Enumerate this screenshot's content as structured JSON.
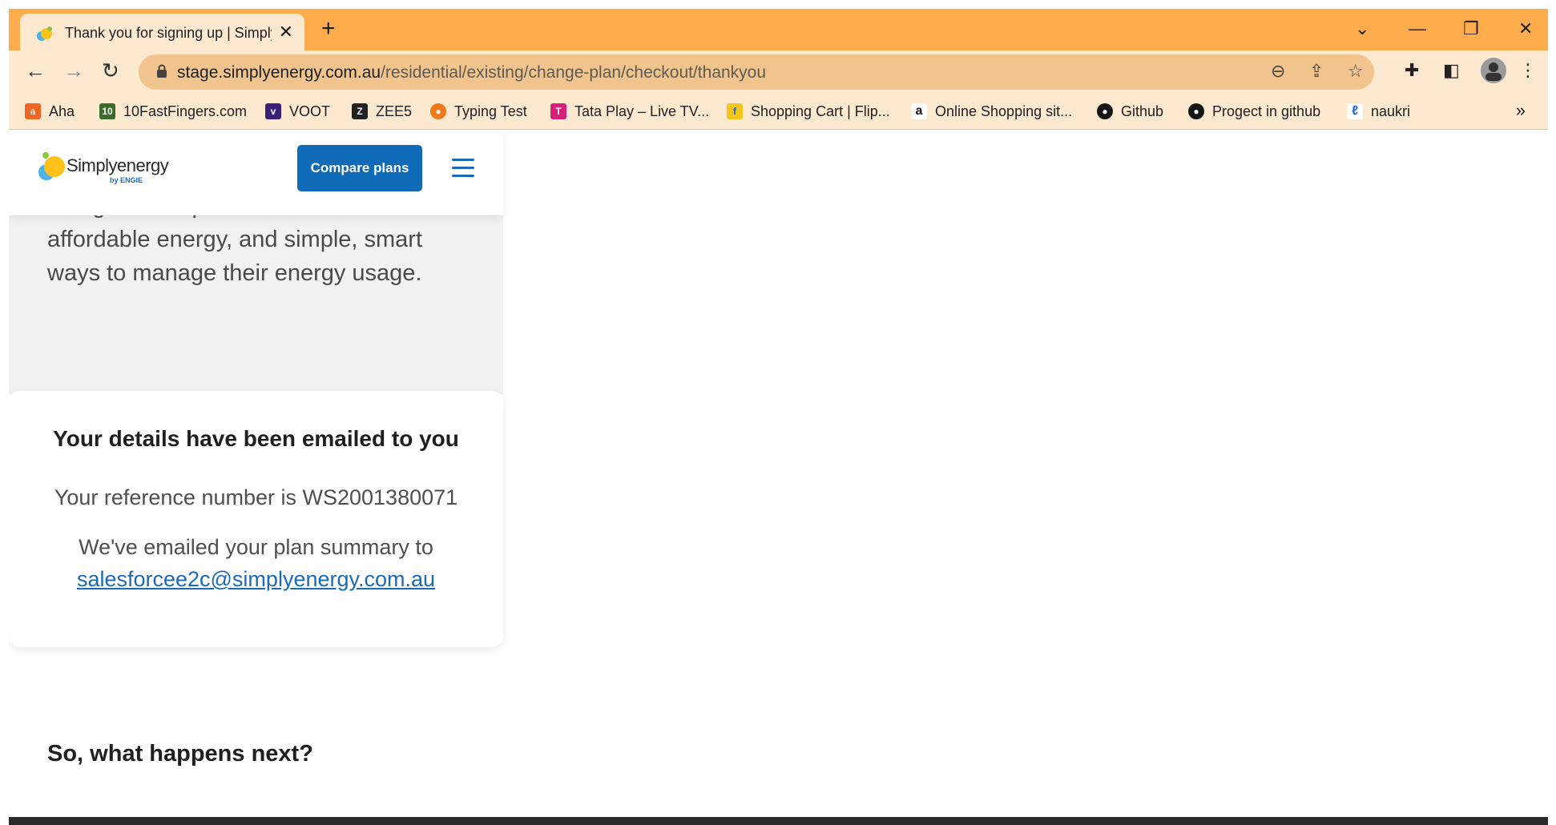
{
  "browser": {
    "tab_title": "Thank you for signing up | Simply",
    "url_host": "stage.simplyenergy.com.au",
    "url_path": "/residential/existing/change-plan/checkout/thankyou",
    "bookmarks": [
      {
        "label": "Aha",
        "color": "#f26522"
      },
      {
        "label": "10FastFingers.com",
        "color": "#3a6b2a"
      },
      {
        "label": "VOOT",
        "color": "#3a1f7a"
      },
      {
        "label": "ZEE5",
        "color": "#222222"
      },
      {
        "label": "Typing Test",
        "color": "#f07a1a"
      },
      {
        "label": "Tata Play – Live TV...",
        "color": "#d6207a"
      },
      {
        "label": "Shopping Cart | Flip...",
        "color": "#f7c51a"
      },
      {
        "label": "Online Shopping sit...",
        "color": "#111111"
      },
      {
        "label": "Github",
        "color": "#161616"
      },
      {
        "label": "Progect in github",
        "color": "#161616"
      },
      {
        "label": "naukri",
        "color": "#1c64d8"
      }
    ]
  },
  "header": {
    "logo_text": "Simplyenergy",
    "logo_sub": "by ENGIE",
    "compare_label": "Compare plans"
  },
  "intro": {
    "text": "Our goal is to provide Australians with affordable energy, and simple, smart ways to manage their energy usage."
  },
  "card": {
    "heading": "Your details have been emailed to you",
    "reference": "Your reference number is WS2001380071",
    "emailed_label": "We've emailed your plan summary to",
    "email": "salesforcee2c@simplyenergy.com.au"
  },
  "next": {
    "heading": "So, what happens next?"
  },
  "colors": {
    "brand_blue": "#0f6ab8",
    "chrome_orange": "#ffad4c"
  }
}
